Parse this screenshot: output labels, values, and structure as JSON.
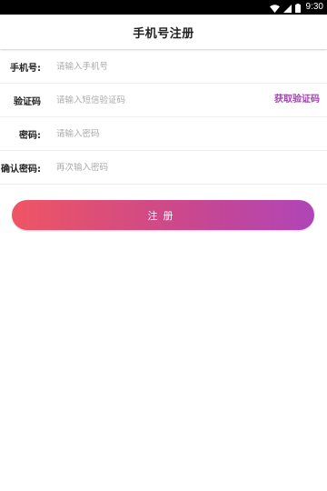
{
  "status_bar": {
    "time": "9:30",
    "icons": [
      "wifi-icon",
      "signal-icon",
      "battery-icon"
    ]
  },
  "header": {
    "title": "手机号注册"
  },
  "form": {
    "phone": {
      "label": "手机号:",
      "placeholder": "请输入手机号",
      "value": ""
    },
    "code": {
      "label": "验证码",
      "placeholder": "请输入短信验证码",
      "value": "",
      "action_label": "获取验证码"
    },
    "password": {
      "label": "密码:",
      "placeholder": "请输入密码",
      "value": ""
    },
    "confirm": {
      "label": "确认密码:",
      "placeholder": "再次输入密码",
      "value": ""
    }
  },
  "register_button": {
    "label": "注册"
  },
  "colors": {
    "accent": "#a345b0",
    "gradient_start": "#ef5563",
    "gradient_end": "#b045b8"
  }
}
